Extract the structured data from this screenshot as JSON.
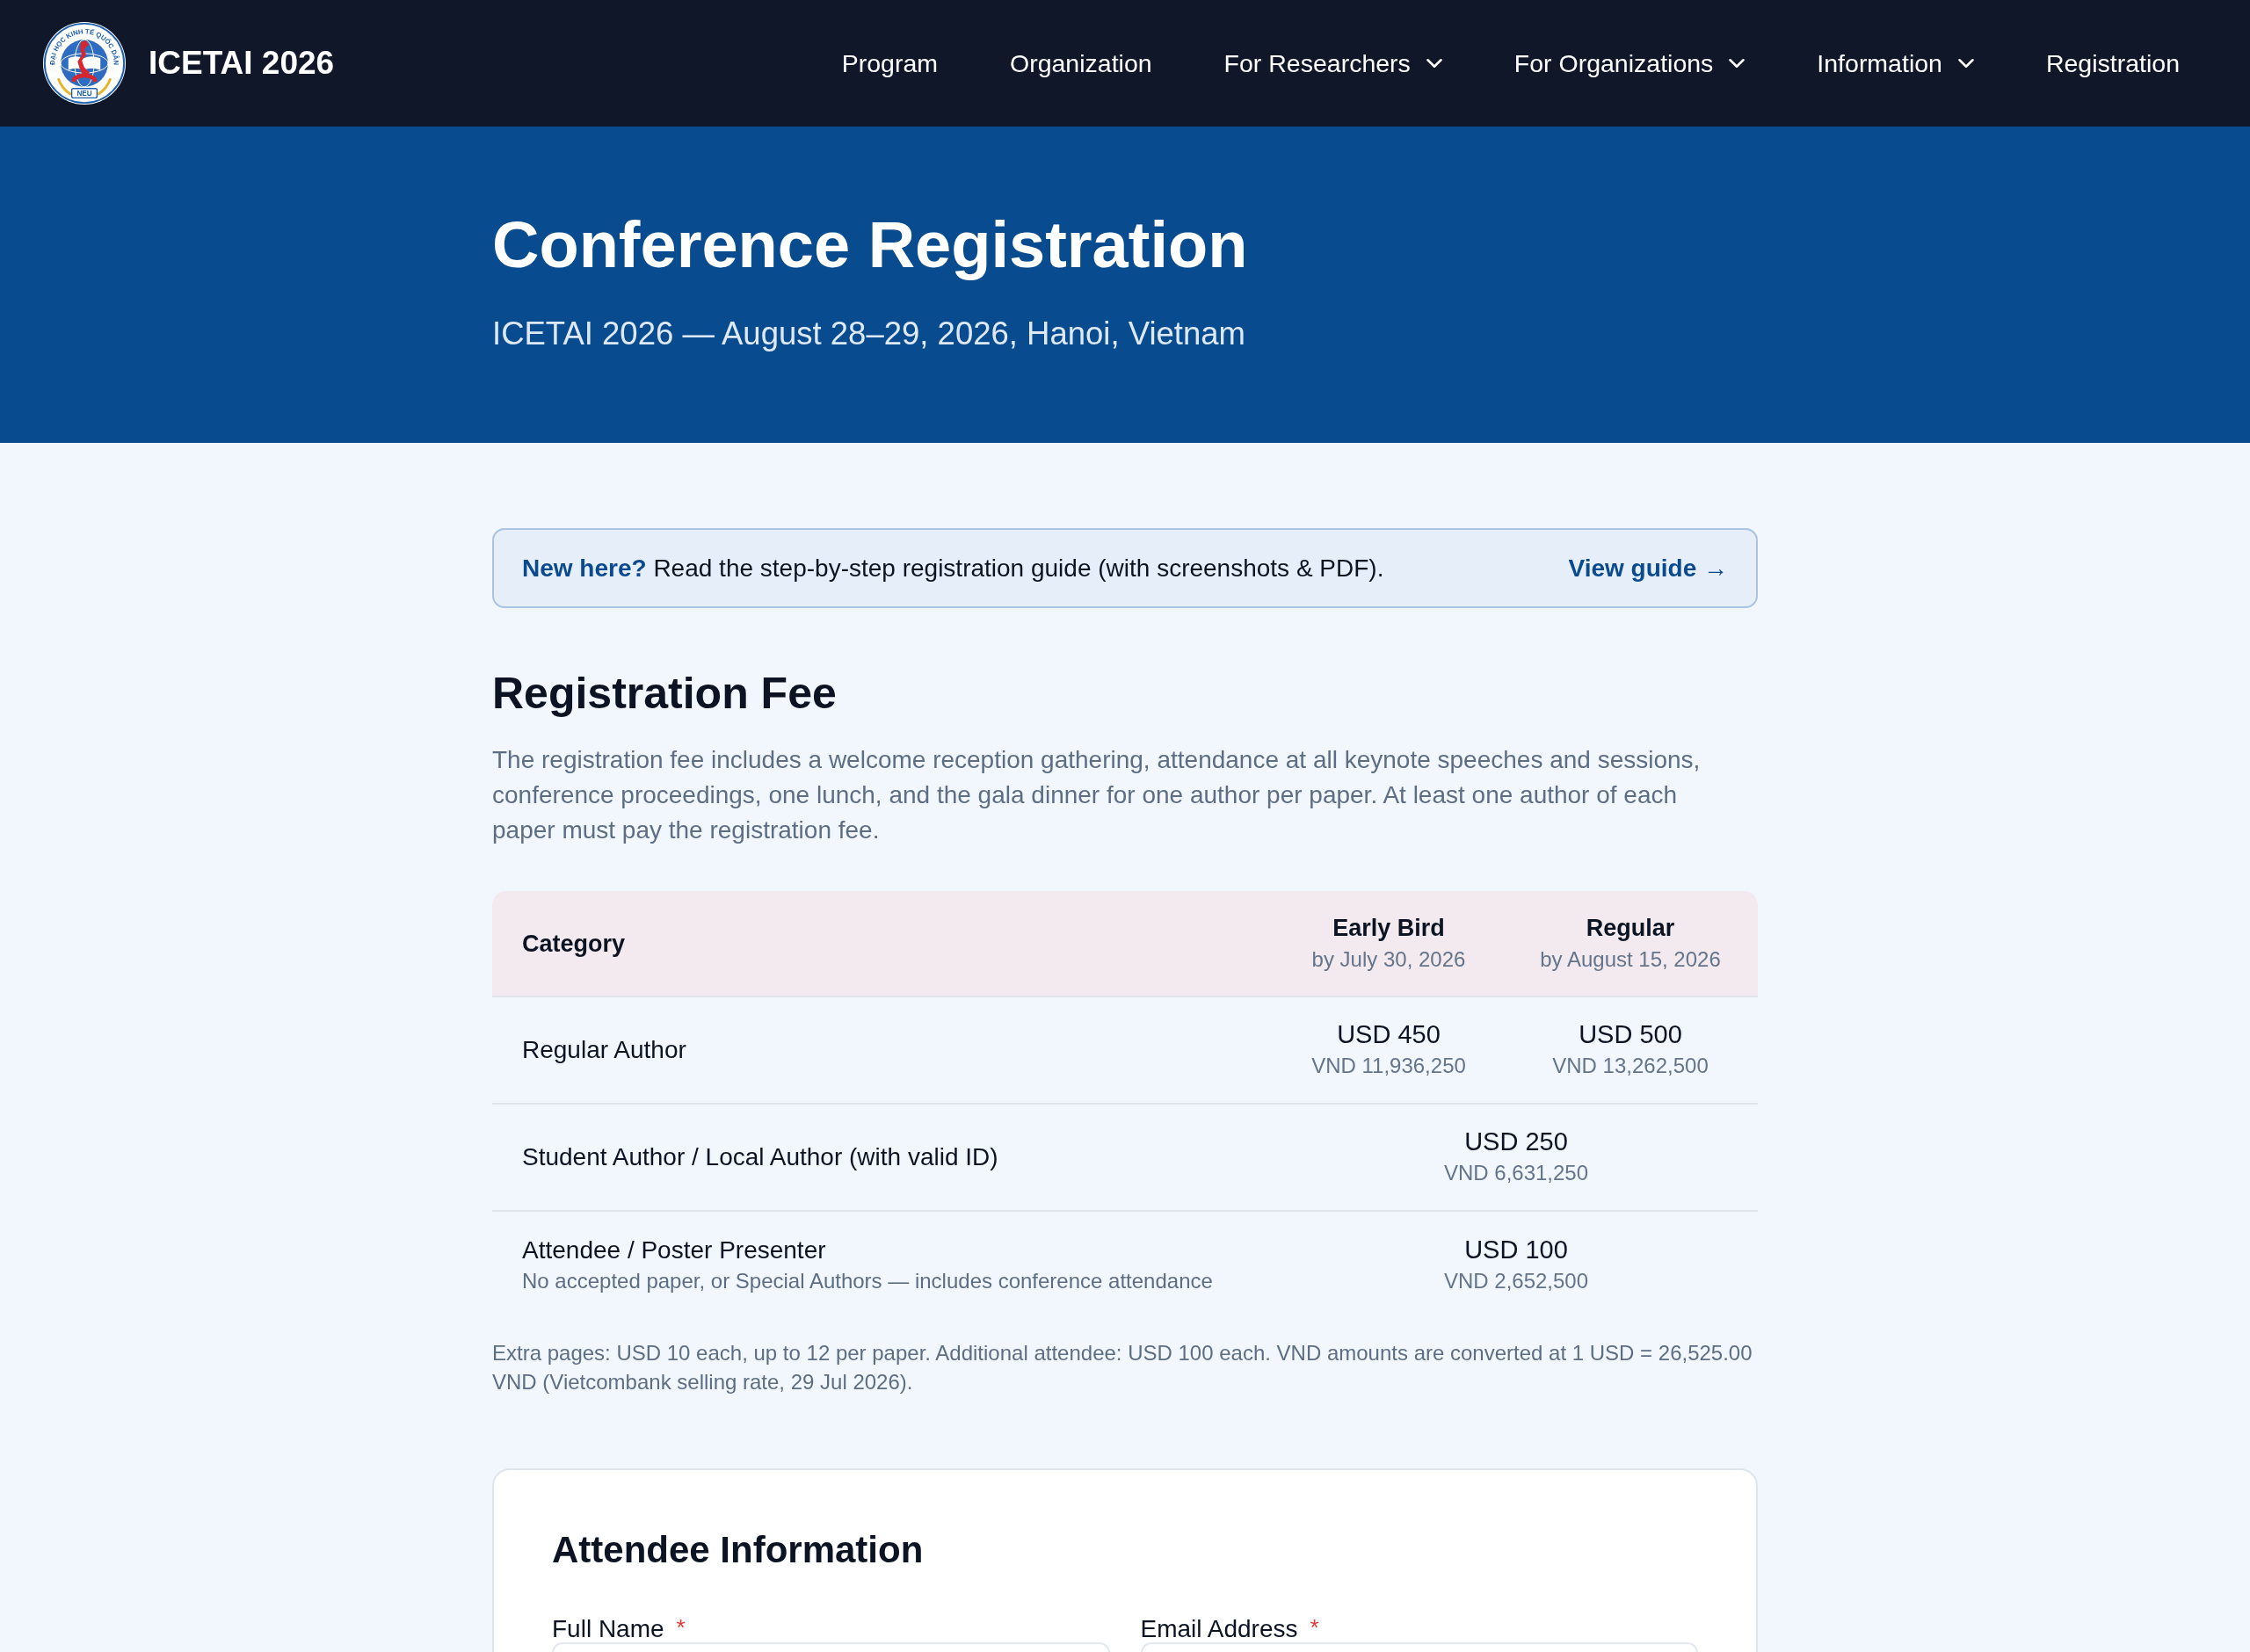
{
  "header": {
    "logo": {
      "ring_text": "ĐẠI HỌC KINH TẾ QUỐC DÂN",
      "badge": "NEU"
    },
    "title": "ICETAI 2026",
    "nav": [
      {
        "label": "Program",
        "has_menu": false
      },
      {
        "label": "Organization",
        "has_menu": false
      },
      {
        "label": "For Researchers",
        "has_menu": true
      },
      {
        "label": "For Organizations",
        "has_menu": true
      },
      {
        "label": "Information",
        "has_menu": true
      },
      {
        "label": "Registration",
        "has_menu": false
      }
    ]
  },
  "hero": {
    "title": "Conference Registration",
    "subtitle": "ICETAI 2026 — August 28–29, 2026, Hanoi, Vietnam"
  },
  "guide": {
    "message": "**New here?** Read the step-by-step registration guide (with screenshots & PDF).",
    "link": "View guide →"
  },
  "fees": {
    "heading": "Registration Fee",
    "description": "The registration fee includes a welcome reception gathering, attendance at all keynote speeches and sessions, conference proceedings, one lunch, and the gala dinner for one author per paper. At least one author of each paper must pay the registration fee.",
    "columns": [
      {
        "label": "Category"
      },
      {
        "label": "Early Bird",
        "note": "by July 30, 2026"
      },
      {
        "label": "Regular",
        "note": "by August 15, 2026"
      }
    ],
    "rows": [
      {
        "category": "Regular Author",
        "prices": [
          {
            "usd": "USD 450",
            "vnd": "VND 11,936,250"
          },
          {
            "usd": "USD 500",
            "vnd": "VND 13,262,500"
          }
        ]
      },
      {
        "category": "Student Author / Local Author (with valid ID)",
        "prices": [
          {
            "usd": "USD 250",
            "vnd": "VND 6,631,250"
          }
        ]
      },
      {
        "category": "Attendee / Poster Presenter",
        "detail": "No accepted paper, or Special Authors — includes conference attendance",
        "prices": [
          {
            "usd": "USD 100",
            "vnd": "VND 2,652,500"
          }
        ]
      }
    ],
    "footnote": "Extra pages: USD 10 each, up to 12 per paper. Additional attendee: USD 100 each. VND amounts are converted at 1 USD = 26,525.00 VND (Vietcombank selling rate, 29 Jul 2026)."
  },
  "attendee_form": {
    "heading": "Attendee Information",
    "fields": [
      {
        "label": "Full Name",
        "required_mark": "*"
      },
      {
        "label": "Email Address",
        "required_mark": "*"
      }
    ]
  }
}
